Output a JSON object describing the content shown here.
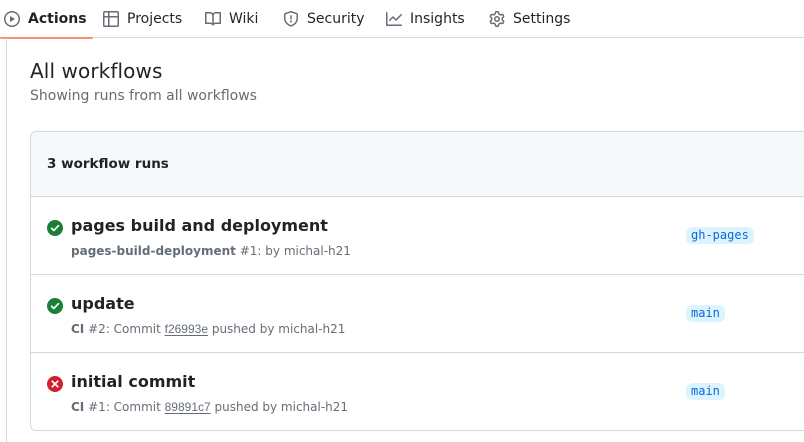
{
  "nav": {
    "items": [
      {
        "label": "Actions",
        "icon": "play-icon",
        "active": true
      },
      {
        "label": "Projects",
        "icon": "table-icon",
        "active": false
      },
      {
        "label": "Wiki",
        "icon": "book-icon",
        "active": false
      },
      {
        "label": "Security",
        "icon": "shield-icon",
        "active": false
      },
      {
        "label": "Insights",
        "icon": "graph-icon",
        "active": false
      },
      {
        "label": "Settings",
        "icon": "gear-icon",
        "active": false
      }
    ]
  },
  "header": {
    "title": "All workflows",
    "subtitle": "Showing runs from all workflows"
  },
  "runs_box": {
    "count_label": "3 workflow runs",
    "runs": [
      {
        "status": "success",
        "title": "pages build and deployment",
        "workflow": "pages-build-deployment",
        "run_number": "#1",
        "description_prefix": ": by michal-h21",
        "commit": "",
        "description_suffix": "",
        "branch": "gh-pages"
      },
      {
        "status": "success",
        "title": "update",
        "workflow": "CI",
        "run_number": "#2",
        "description_prefix": ": Commit ",
        "commit": "f26993e",
        "description_suffix": " pushed by michal-h21",
        "branch": "main"
      },
      {
        "status": "failure",
        "title": "initial commit",
        "workflow": "CI",
        "run_number": "#1",
        "description_prefix": ": Commit ",
        "commit": "89891c7",
        "description_suffix": " pushed by michal-h21",
        "branch": "main"
      }
    ]
  },
  "colors": {
    "success": "#1a7f37",
    "failure": "#cf222e",
    "active_tab_underline": "#fd8c73",
    "branch_bg": "#ddf4ff",
    "branch_text": "#0969da"
  }
}
